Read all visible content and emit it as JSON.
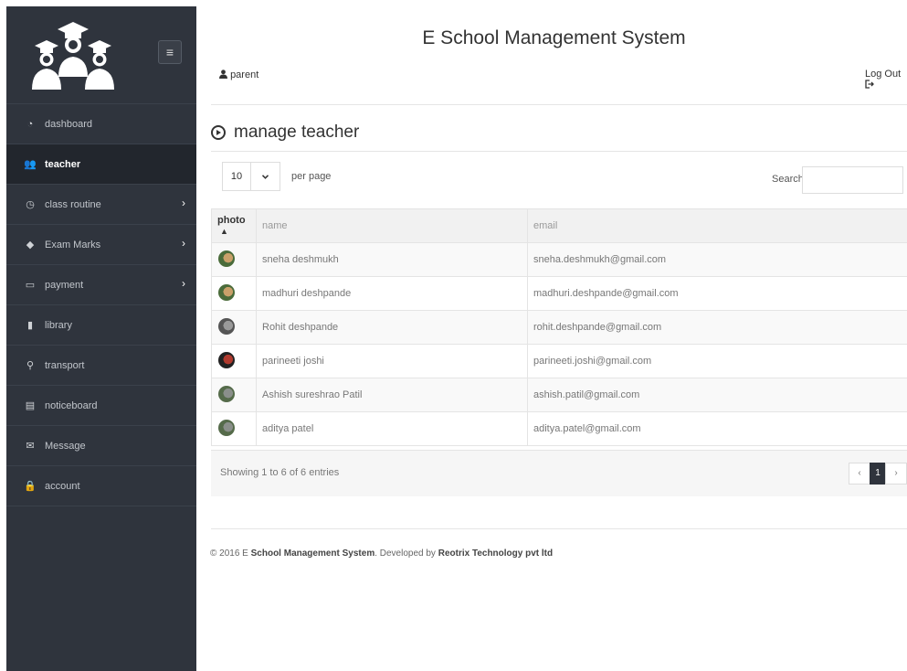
{
  "sidebar": {
    "menu_icon": "hamburger-icon",
    "items": [
      {
        "label": "dashboard",
        "icon": "dashboard-gauge-icon",
        "active": false,
        "has_submenu": false
      },
      {
        "label": "teacher",
        "icon": "users-icon",
        "active": true,
        "has_submenu": false
      },
      {
        "label": "class routine",
        "icon": "clock-icon",
        "active": false,
        "has_submenu": true
      },
      {
        "label": "Exam Marks",
        "icon": "graduation-cap-icon",
        "active": false,
        "has_submenu": true
      },
      {
        "label": "payment",
        "icon": "credit-card-icon",
        "active": false,
        "has_submenu": true
      },
      {
        "label": "library",
        "icon": "book-icon",
        "active": false,
        "has_submenu": false
      },
      {
        "label": "transport",
        "icon": "map-marker-icon",
        "active": false,
        "has_submenu": false
      },
      {
        "label": "noticeboard",
        "icon": "notice-icon",
        "active": false,
        "has_submenu": false
      },
      {
        "label": "Message",
        "icon": "envelope-icon",
        "active": false,
        "has_submenu": false
      },
      {
        "label": "account",
        "icon": "lock-icon",
        "active": false,
        "has_submenu": false
      }
    ]
  },
  "header": {
    "title": "E School Management System",
    "user": "parent",
    "logout": "Log Out"
  },
  "page": {
    "title": "manage teacher"
  },
  "table_controls": {
    "per_page_value": "10",
    "per_page_label": "per page",
    "search_label": "Search:",
    "search_value": ""
  },
  "table": {
    "columns": [
      "photo",
      "name",
      "email"
    ],
    "rows": [
      {
        "name": "sneha deshmukh",
        "email": "sneha.deshmukh@gmail.com"
      },
      {
        "name": "madhuri deshpande",
        "email": "madhuri.deshpande@gmail.com"
      },
      {
        "name": "Rohit deshpande",
        "email": "rohit.deshpande@gmail.com"
      },
      {
        "name": "parineeti joshi",
        "email": "parineeti.joshi@gmail.com"
      },
      {
        "name": "Ashish sureshrao Patil",
        "email": "ashish.patil@gmail.com"
      },
      {
        "name": "aditya patel",
        "email": "aditya.patel@gmail.com"
      }
    ]
  },
  "pagination": {
    "info": "Showing 1 to 6 of 6 entries",
    "prev": "‹",
    "current": "1",
    "next": "›"
  },
  "footer": {
    "prefix": "© 2016 E ",
    "brand": "School Management System",
    "middle": ". Developed by ",
    "company": "Reotrix Technology pvt ltd"
  },
  "colors": {
    "sidebar_bg": "#2f343d",
    "sidebar_active_bg": "#22262d",
    "header_bg": "#f1f1f1"
  }
}
